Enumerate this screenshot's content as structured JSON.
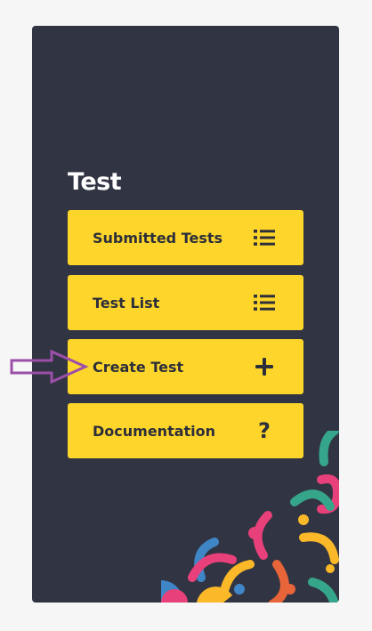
{
  "section": {
    "title": "Test"
  },
  "menu": {
    "items": [
      {
        "label": "Submitted Tests",
        "icon": "list-icon"
      },
      {
        "label": "Test List",
        "icon": "list-icon"
      },
      {
        "label": "Create Test",
        "icon": "plus-icon"
      },
      {
        "label": "Documentation",
        "icon": "question-icon",
        "icon_glyph": "?"
      }
    ]
  },
  "colors": {
    "page_bg": "#f6f6f7",
    "panel_bg": "#313442",
    "button_bg": "#fed52a",
    "button_text": "#2c2f3a",
    "annotation_arrow": "#9b4fa8"
  },
  "annotation": {
    "type": "arrow-pointer",
    "target": "Create Test"
  }
}
